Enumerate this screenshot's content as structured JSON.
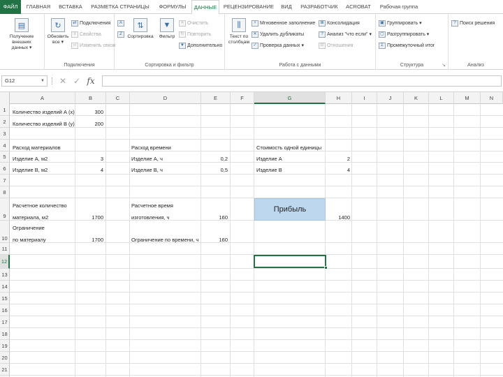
{
  "ribbon": {
    "tabs": [
      {
        "label": "ФАЙЛ",
        "kind": "file"
      },
      {
        "label": "ГЛАВНАЯ"
      },
      {
        "label": "ВСТАВКА"
      },
      {
        "label": "РАЗМЕТКА СТРАНИЦЫ"
      },
      {
        "label": "ФОРМУЛЫ"
      },
      {
        "label": "ДАННЫЕ",
        "kind": "active"
      },
      {
        "label": "РЕЦЕНЗИРОВАНИЕ"
      },
      {
        "label": "ВИД"
      },
      {
        "label": "РАЗРАБОТЧИК"
      },
      {
        "label": "ACROBAT"
      },
      {
        "label": "Рабочая группа"
      }
    ],
    "groups": {
      "external": {
        "btn_label": "Получение внешних данных ▾"
      },
      "connections": {
        "label": "Подключения",
        "refresh": "Обновить все ▾",
        "items": [
          "Подключения",
          "Свойства",
          "Изменить связи"
        ]
      },
      "sort": {
        "label": "Сортировка и фильтр",
        "sort_btn": "Сортировка",
        "filter_btn": "Фильтр",
        "items": [
          "Очистить",
          "Повторить",
          "Дополнительно"
        ]
      },
      "tools": {
        "label": "Работа с данными",
        "text_btn": "Текст по столбцам",
        "items": [
          "Мгновенное заполнение",
          "Удалить дубликаты",
          "Проверка данных ▾",
          "Консолидация",
          "Анализ \"что если\" ▾",
          "Отношения"
        ]
      },
      "outline": {
        "label": "Структура",
        "items": [
          "Группировать ▾",
          "Разгруппировать ▾",
          "Промежуточный итог"
        ]
      },
      "analysis": {
        "label": "Анализ",
        "items": [
          "Поиск решения"
        ]
      }
    }
  },
  "formula_bar": {
    "name_box": "G12",
    "fx": "fx",
    "value": ""
  },
  "grid": {
    "columns": [
      "A",
      "B",
      "C",
      "D",
      "E",
      "F",
      "G",
      "H",
      "I",
      "J",
      "K",
      "L",
      "M",
      "N"
    ],
    "selected_column": "G",
    "rows": [
      "1",
      "2",
      "3",
      "4",
      "5",
      "6",
      "7",
      "8",
      "9",
      "10",
      "11",
      "12",
      "13",
      "14",
      "15",
      "16",
      "17",
      "18",
      "19",
      "20",
      "21",
      "22"
    ],
    "selected_row": "12",
    "cells": {
      "A1": "Количество изделий А (x)",
      "B1": "300",
      "A2": "Количество изделий В (y)",
      "B2": "200",
      "A4": "Расход материалов",
      "D4": "Расход времени",
      "G4": "Стоимость одной единицы",
      "A5": "Изделие А, м2",
      "B5": "3",
      "D5": "Изделие А, ч",
      "E5": "0,2",
      "G5": "Изделие А",
      "H5": "2",
      "A6": "Изделие В, м2",
      "B6": "4",
      "D6": "Изделие В, ч",
      "E6": "0,5",
      "G6": "Изделие В",
      "H6": "4",
      "A9a": "Расчетное количество",
      "A9b": "материала, м2",
      "B9": "1700",
      "D9a": "Расчетное время",
      "D9b": "изготовления, ч",
      "E9": "160",
      "H9": "1400",
      "A10a": "Ограничение",
      "A10b": "по материалу",
      "B10": "1700",
      "D10": "Ограничение по времени, ч",
      "E10": "160"
    },
    "button_label": "Прибыль"
  }
}
